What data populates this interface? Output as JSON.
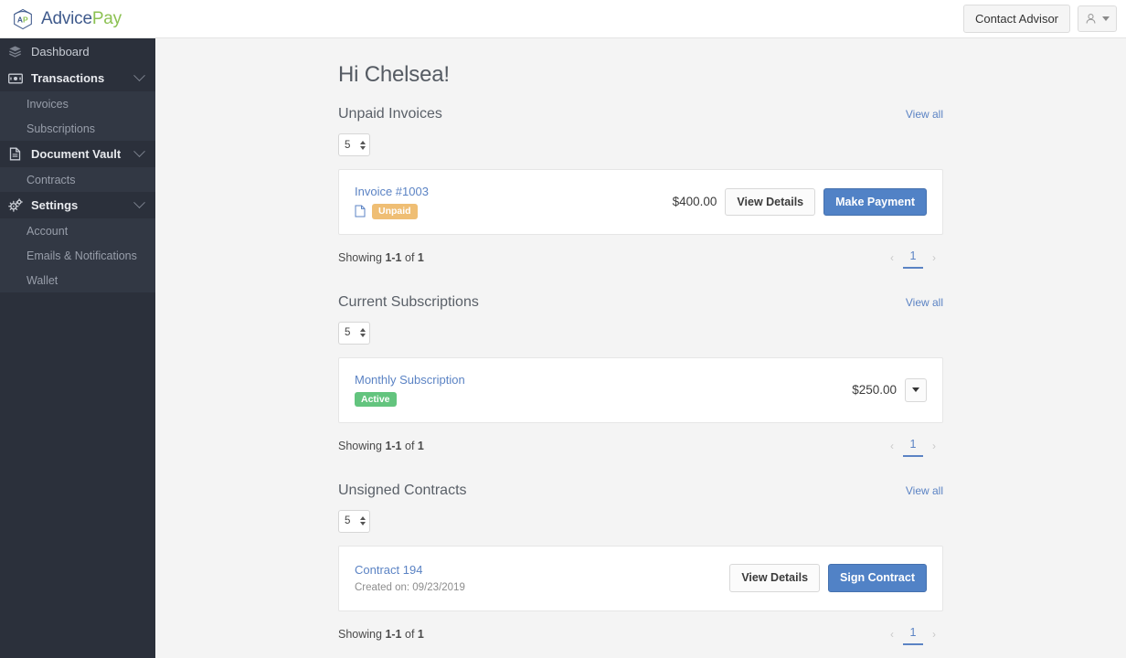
{
  "brand": {
    "advice": "Advice",
    "pay": "Pay",
    "mark_icon": "advicepay-hexagon-logo"
  },
  "header": {
    "contact_advisor_label": "Contact Advisor",
    "user_icon": "user-icon",
    "caret_icon": "chevron-down-icon"
  },
  "sidebar": {
    "items": [
      {
        "label": "Dashboard",
        "icon": "layers-icon",
        "bold": false,
        "expandable": false
      },
      {
        "label": "Transactions",
        "icon": "money-bill-icon",
        "bold": true,
        "expandable": true
      },
      {
        "label": "Document Vault",
        "icon": "document-icon",
        "bold": true,
        "expandable": true
      },
      {
        "label": "Settings",
        "icon": "gears-icon",
        "bold": true,
        "expandable": true
      }
    ],
    "sub_transactions": [
      "Invoices",
      "Subscriptions"
    ],
    "sub_document_vault": [
      "Contracts"
    ],
    "sub_settings": [
      "Account",
      "Emails & Notifications",
      "Wallet"
    ]
  },
  "main": {
    "greeting": "Hi Chelsea!",
    "view_all_label": "View all",
    "page_size_value": "5",
    "sections": {
      "invoices": {
        "title": "Unpaid Invoices",
        "item": {
          "title": "Invoice #1003",
          "file_icon": "file-icon",
          "badge": "Unpaid",
          "amount": "$400.00",
          "view_details_label": "View Details",
          "primary_label": "Make Payment"
        },
        "showing_prefix": "Showing ",
        "showing_range": "1-1",
        "showing_mid": " of ",
        "showing_total": "1",
        "page": "1"
      },
      "subscriptions": {
        "title": "Current Subscriptions",
        "item": {
          "title": "Monthly Subscription",
          "badge": "Active",
          "amount": "$250.00",
          "menu_icon": "caret-down-icon"
        },
        "showing_prefix": "Showing ",
        "showing_range": "1-1",
        "showing_mid": " of ",
        "showing_total": "1",
        "page": "1"
      },
      "contracts": {
        "title": "Unsigned Contracts",
        "item": {
          "title": "Contract 194",
          "created": "Created on: 09/23/2019",
          "view_details_label": "View Details",
          "primary_label": "Sign Contract"
        },
        "showing_prefix": "Showing ",
        "showing_range": "1-1",
        "showing_mid": " of ",
        "showing_total": "1",
        "page": "1"
      }
    }
  },
  "colors": {
    "sidebar_bg": "#2b303b",
    "sidebar_sub_bg": "#323844",
    "primary_blue": "#5182c6",
    "link_blue": "#5b83c4",
    "badge_unpaid": "#efbe74",
    "badge_active": "#63c47e",
    "brand_green": "#8cc152",
    "brand_blue": "#3f5a8c",
    "page_bg": "#f4f4f4"
  }
}
